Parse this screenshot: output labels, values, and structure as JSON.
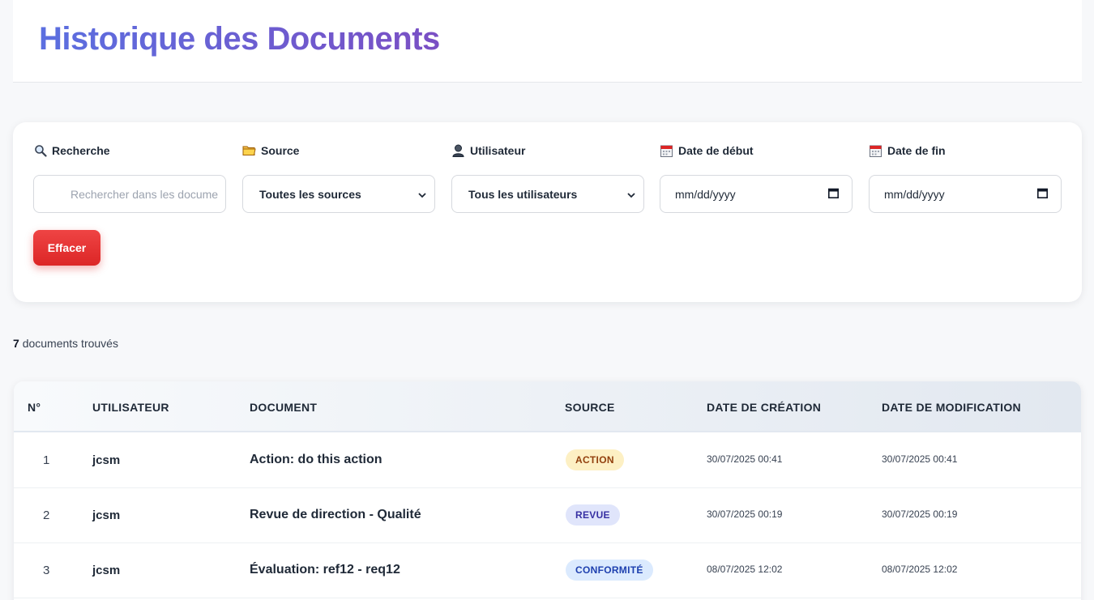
{
  "header": {
    "title": "Historique des Documents"
  },
  "filters": {
    "search": {
      "label": "Recherche",
      "placeholder": "Rechercher dans les docume"
    },
    "source": {
      "label": "Source",
      "value": "Toutes les sources"
    },
    "user": {
      "label": "Utilisateur",
      "value": "Tous les utilisateurs"
    },
    "date_start": {
      "label": "Date de début",
      "value": "mm/dd/yyyy"
    },
    "date_end": {
      "label": "Date de fin",
      "value": "mm/dd/yyyy"
    },
    "clear_label": "Effacer"
  },
  "results": {
    "count": "7",
    "label": "documents trouvés"
  },
  "table": {
    "columns": [
      "N°",
      "Utilisateur",
      "Document",
      "Source",
      "Date de création",
      "Date de modification"
    ],
    "rows": [
      {
        "num": "1",
        "user": "jcsm",
        "document": "Action: do this action",
        "source": "ACTION",
        "source_bg": "#fdf0c4",
        "source_color": "#92400e",
        "created": "30/07/2025 00:41",
        "modified": "30/07/2025 00:41"
      },
      {
        "num": "2",
        "user": "jcsm",
        "document": "Revue de direction - Qualité",
        "source": "REVUE",
        "source_bg": "#e0e5fb",
        "source_color": "#3730a3",
        "created": "30/07/2025 00:19",
        "modified": "30/07/2025 00:19"
      },
      {
        "num": "3",
        "user": "jcsm",
        "document": "Évaluation: ref12 - req12",
        "source": "CONFORMITÉ",
        "source_bg": "#dbeafe",
        "source_color": "#1e40af",
        "created": "08/07/2025 12:02",
        "modified": "08/07/2025 12:02"
      }
    ]
  },
  "colors": {
    "accent": "#5b6fe0",
    "danger": "#ef4444"
  }
}
